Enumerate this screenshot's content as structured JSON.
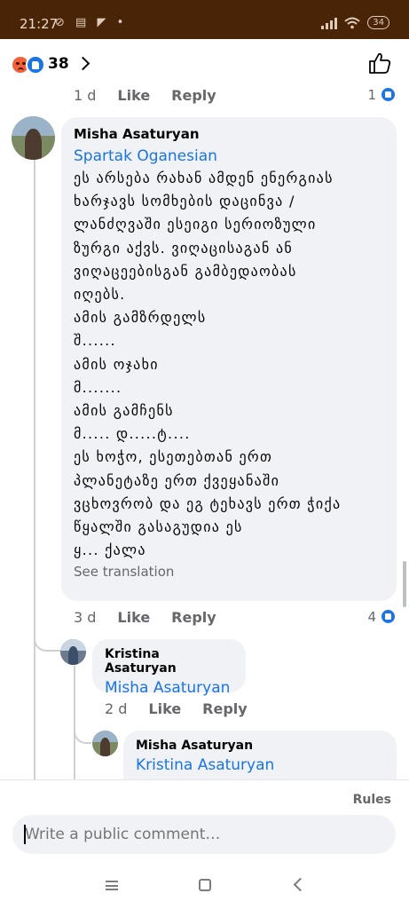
{
  "status_bar": {
    "time": "21:27",
    "left_icons": "⊘ ▤ ◤ •",
    "battery": "34"
  },
  "reactions": {
    "count": "38",
    "icons": [
      "angry-reaction-icon",
      "like-reaction-icon"
    ]
  },
  "prev_comment_meta": {
    "time": "1 d",
    "like_label": "Like",
    "reply_label": "Reply",
    "like_count": "1"
  },
  "comment_main": {
    "author": "Misha Asaturyan",
    "tag": "Spartak Oganesian",
    "lines": [
      "ეს არსება რახან ამდენ ენერგიას",
      "ხარჯავს სომხების დაცინვა /",
      "ლანძღვაში ესეიგი სერიოზული",
      "ზურგი აქვს. ვიღაცისაგან ან",
      "ვიღაცეებისგან გამბედაობას",
      "იღებს.",
      "ამის გამზრდელს",
      "შ......",
      "ამის ოჯახი",
      "მ.......",
      "ამის გამჩენს",
      "მ..... დ.....ტ....",
      "ეს ხოჭო, ესეთებთან ერთ",
      "პლანეტაზე ერთ ქვეყანაში",
      "ვცხოვრობ და ეგ ტეხავს ერთ ჭიქა",
      "წყალში გასაგუდია ეს",
      "ყ... ქალა"
    ],
    "see_translation": "See translation",
    "time": "3 d",
    "like_label": "Like",
    "reply_label": "Reply",
    "like_count": "4"
  },
  "reply_1": {
    "author": "Kristina  Asaturyan",
    "tag": "Misha Asaturyan",
    "time": "2 d",
    "like_label": "Like",
    "reply_label": "Reply"
  },
  "reply_2": {
    "author": "Misha Asaturyan",
    "tag": "Kristina  Asaturyan"
  },
  "composer": {
    "rules_label": "Rules",
    "placeholder": "Write a public comment…"
  },
  "colors": {
    "status_bar_bg": "#4a2407",
    "link_blue": "#1b74e4",
    "bubble_bg": "#f0f2f5",
    "meta_gray": "#65676b"
  }
}
